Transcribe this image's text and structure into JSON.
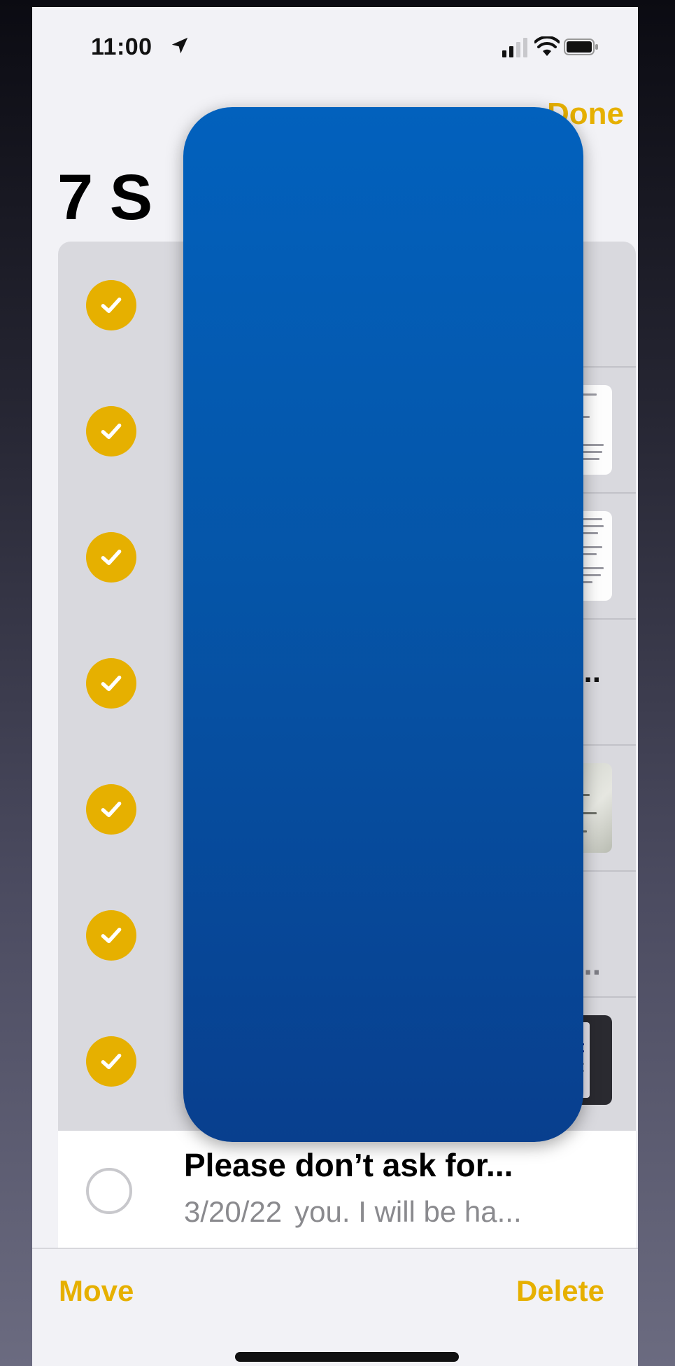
{
  "status_bar": {
    "time": "11:00",
    "icons": [
      "location-arrow-icon",
      "signal-icon",
      "wifi-icon",
      "battery-icon"
    ]
  },
  "header": {
    "done_label": "Done",
    "title": "7 S"
  },
  "selected_rows": {
    "row4_text": "/...",
    "row6_text": "st..."
  },
  "unselected_note": {
    "title": "Please don’t ask for...",
    "date": "3/20/22",
    "preview": "you. I will be ha..."
  },
  "toolbar": {
    "move_label": "Move",
    "delete_label": "Delete"
  },
  "colors": {
    "accent": "#e6b000",
    "overlay": "#0555a8",
    "background": "#f2f2f6"
  }
}
